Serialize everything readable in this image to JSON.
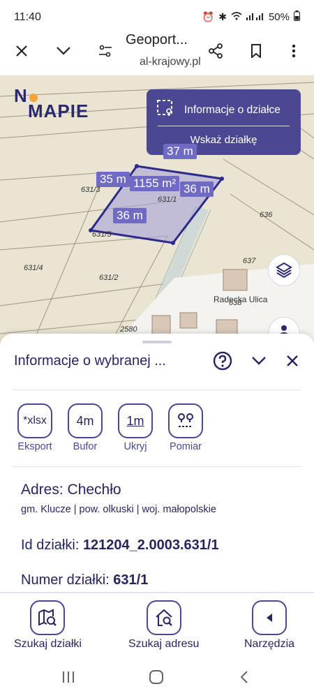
{
  "status": {
    "time": "11:40",
    "battery": "50%"
  },
  "browser": {
    "title": "Geoport...",
    "url": "al-krajowy.pl"
  },
  "map": {
    "logo_line1": "N",
    "logo_line1b": "",
    "logo_line2": "MAPIE",
    "info_panel": {
      "title": "Informacje o działce",
      "action": "Wskaż działkę"
    },
    "measurements": [
      "37 m",
      "35 m",
      "1155 m²",
      "36 m",
      "36 m"
    ],
    "plot_numbers": [
      "631/3",
      "631/1",
      "636",
      "631/5",
      "631/4",
      "631/2",
      "637",
      "638",
      "2580"
    ],
    "street": "Radecka Ulica"
  },
  "sheet": {
    "title": "Informacje o wybranej ...",
    "tools": [
      {
        "icon": "*xlsx",
        "label": "Eksport"
      },
      {
        "icon": "4m",
        "label": "Bufor"
      },
      {
        "icon": "1m",
        "label": "Ukryj"
      },
      {
        "icon": "",
        "label": "Pomiar"
      }
    ],
    "address_title": "Adres: Chechło",
    "address_sub": "gm. Klucze | pow. olkuski | woj. małopolskie",
    "id_label": "Id działki: ",
    "id_value": "121204_2.0003.631/1",
    "num_label": "Numer działki: ",
    "num_value": "631/1"
  },
  "nav": {
    "items": [
      {
        "label": "Szukaj działki"
      },
      {
        "label": "Szukaj adresu"
      },
      {
        "label": "Narzędzia"
      }
    ]
  },
  "colors": {
    "primary": "#4b4893",
    "dark": "#27255f",
    "parcel": "#6f6ac4"
  }
}
